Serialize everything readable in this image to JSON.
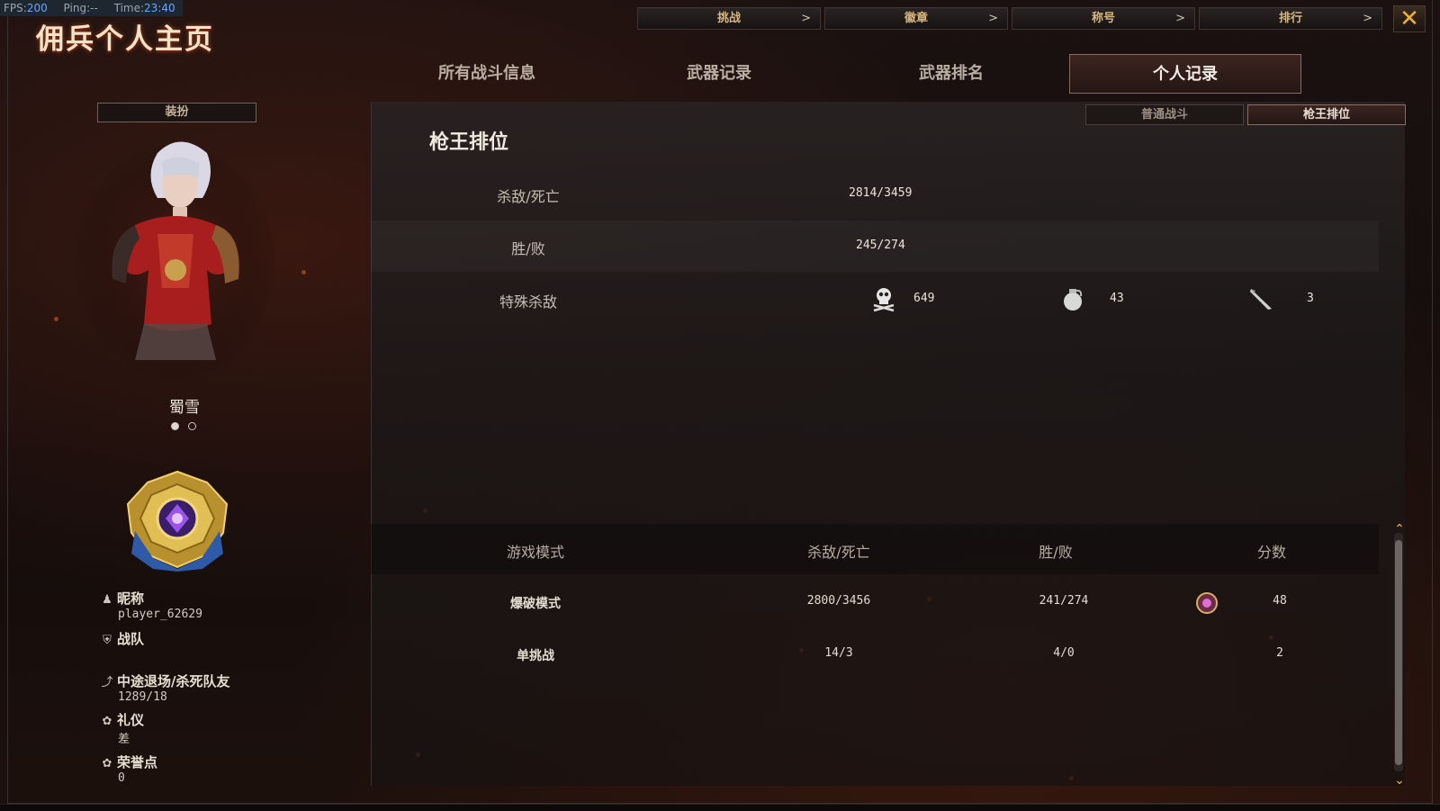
{
  "fps_bar": {
    "fps_label": "FPS:",
    "fps": "200",
    "ping_label": "Ping:",
    "ping": "--",
    "time_label": "Time:",
    "time": "23:40"
  },
  "title": "佣兵个人主页",
  "top_nav": [
    {
      "label": "挑战",
      "arrow": ">"
    },
    {
      "label": "徽章",
      "arrow": ">"
    },
    {
      "label": "称号",
      "arrow": ">"
    },
    {
      "label": "排行",
      "arrow": ">"
    }
  ],
  "close_label": "✕",
  "main_tabs": [
    {
      "label": "所有战斗信息",
      "active": false
    },
    {
      "label": "武器记录",
      "active": false
    },
    {
      "label": "武器排名",
      "active": false
    },
    {
      "label": "个人记录",
      "active": true
    }
  ],
  "left_panel": {
    "outfit_button": "装扮",
    "character_name": "蜀雪",
    "nickname_label": "昵称",
    "nickname": "player_62629",
    "clan_label": "战队",
    "clan": "",
    "quit_teamkill_label": "中途退场/杀死队友",
    "quit_teamkill": "1289/18",
    "etiquette_label": "礼仪",
    "etiquette": "差",
    "honor_label": "荣誉点",
    "honor": "0"
  },
  "sub_tabs": [
    {
      "label": "普通战斗",
      "active": false
    },
    {
      "label": "枪王排位",
      "active": true
    }
  ],
  "section_title": "枪王排位",
  "summary": {
    "kd_label": "杀敌/死亡",
    "kd": "2814/3459",
    "wl_label": "胜/败",
    "wl": "245/274",
    "special_label": "特殊杀敌",
    "special": [
      {
        "icon": "skull-crossbones-icon",
        "value": "649"
      },
      {
        "icon": "grenade-icon",
        "value": "43"
      },
      {
        "icon": "knife-icon",
        "value": "3"
      }
    ]
  },
  "mode_table": {
    "headers": [
      "游戏模式",
      "杀敌/死亡",
      "胜/败",
      "分数"
    ],
    "rows": [
      {
        "mode": "爆破模式",
        "kd": "2800/3456",
        "wl": "241/274",
        "score": "48",
        "rank_icon": true
      },
      {
        "mode": "单挑战",
        "kd": "14/3",
        "wl": "4/0",
        "score": "2",
        "rank_icon": false
      }
    ]
  },
  "colors": {
    "accent_gold": "#d7b680",
    "active_tab_border": "#8a6a58",
    "close_x": "#f0b030"
  }
}
